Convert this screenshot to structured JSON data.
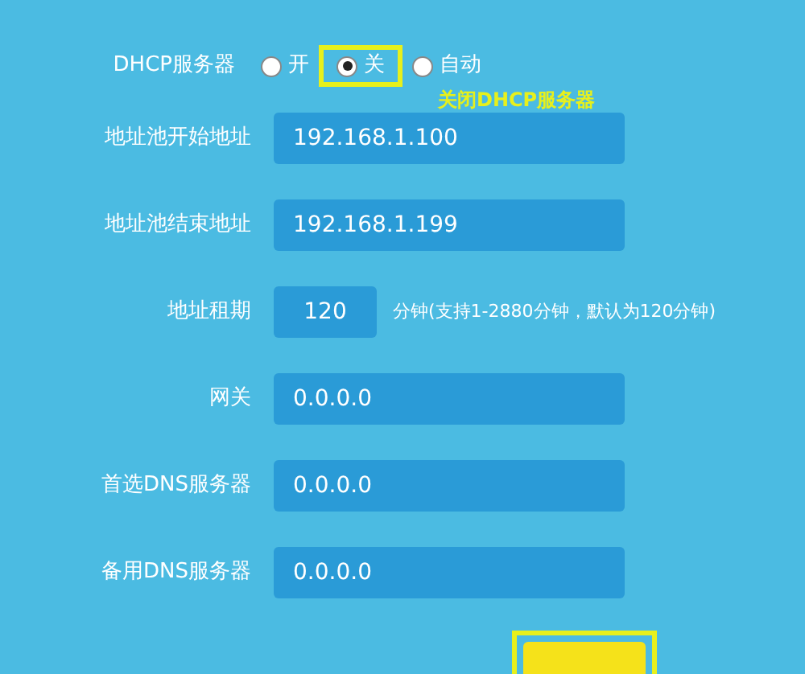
{
  "dhcp_server": {
    "label": "DHCP服务器",
    "options": [
      {
        "label": "开",
        "selected": false
      },
      {
        "label": "关",
        "selected": true
      },
      {
        "label": "自动",
        "selected": false
      }
    ],
    "annotation": "关闭DHCP服务器"
  },
  "fields": [
    {
      "label": "地址池开始地址",
      "value": "192.168.1.100",
      "kind": "wide"
    },
    {
      "label": "地址池结束地址",
      "value": "192.168.1.199",
      "kind": "wide"
    },
    {
      "label": "地址租期",
      "value": "120",
      "kind": "short",
      "hint": "分钟(支持1-2880分钟，默认为120分钟)"
    },
    {
      "label": "网关",
      "value": "0.0.0.0",
      "kind": "wide"
    },
    {
      "label": "首选DNS服务器",
      "value": "0.0.0.0",
      "kind": "wide"
    },
    {
      "label": "备用DNS服务器",
      "value": "0.0.0.0",
      "kind": "wide"
    }
  ]
}
